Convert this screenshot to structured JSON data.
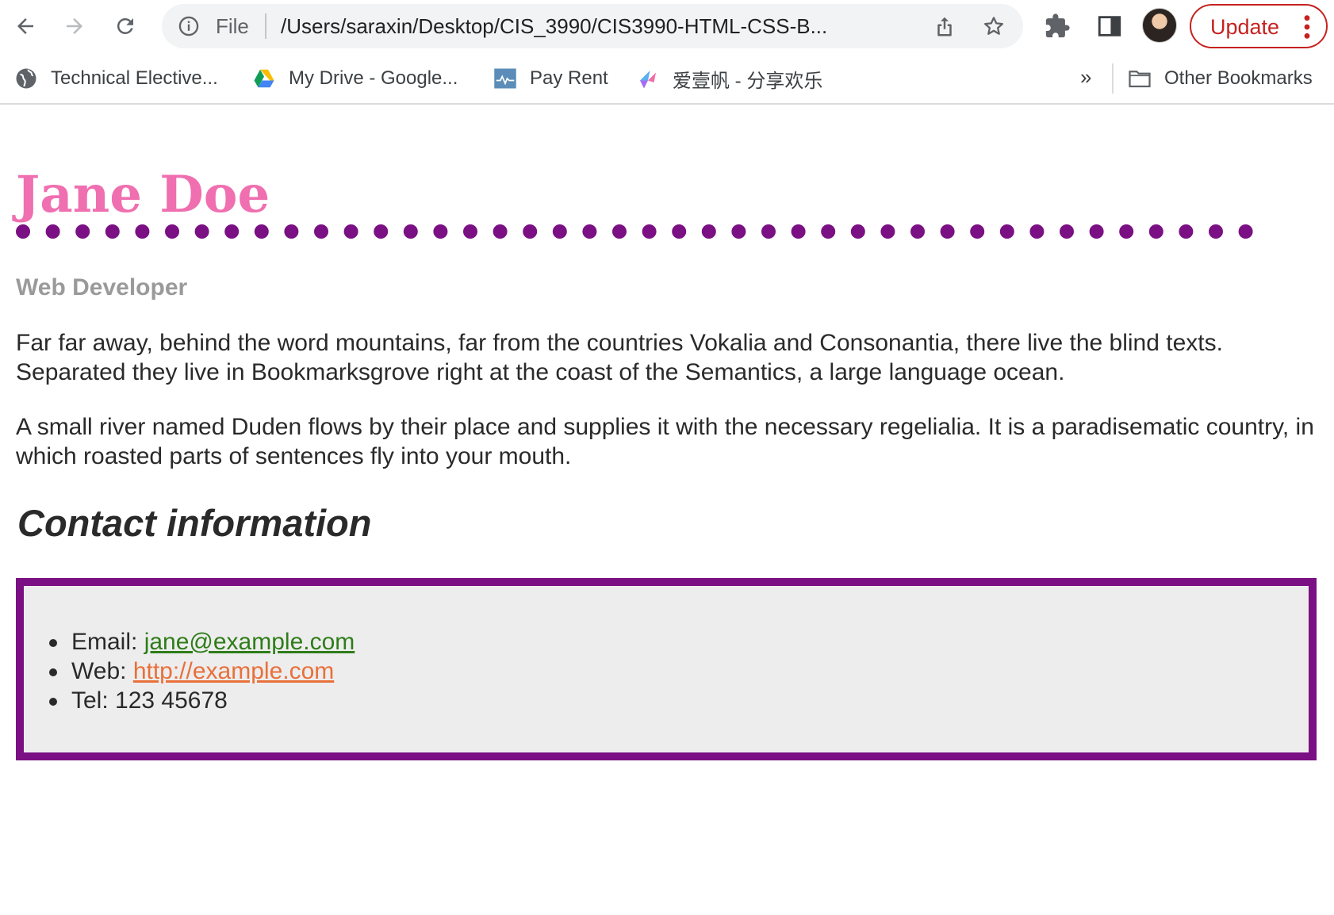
{
  "browser": {
    "omnibox": {
      "scheme_label": "File",
      "url": "/Users/saraxin/Desktop/CIS_3990/CIS3990-HTML-CSS-B..."
    },
    "update_label": "Update",
    "icons": {
      "back": "back-arrow-icon",
      "forward": "forward-arrow-icon",
      "reload": "reload-icon",
      "info": "info-icon",
      "share": "share-icon",
      "bookmark_star": "star-icon",
      "extensions": "puzzle-icon",
      "side_panel": "side-panel-icon",
      "menu": "kebab-menu-icon"
    },
    "colors": {
      "update_red": "#c5221f",
      "omnibox_bg": "#f1f3f4"
    }
  },
  "bookmarks": {
    "items": [
      {
        "label": "Technical Elective...",
        "icon": "globe-icon"
      },
      {
        "label": "My Drive - Google...",
        "icon": "google-drive-icon"
      },
      {
        "label": "Pay Rent",
        "icon": "pay-rent-icon"
      },
      {
        "label": "爱壹帆 - 分享欢乐",
        "icon": "aiyifan-icon"
      }
    ],
    "overflow_label": "»",
    "other_label": "Other Bookmarks",
    "other_icon": "folder-icon"
  },
  "page": {
    "name": "Jane Doe",
    "role": "Web Developer",
    "paragraphs": [
      "Far far away, behind the word mountains, far from the countries Vokalia and Consonantia, there live the blind texts. Separated they live in Bookmarksgrove right at the coast of the Semantics, a large language ocean.",
      "A small river named Duden flows by their place and supplies it with the necessary regelialia. It is a paradisematic country, in which roasted parts of sentences fly into your mouth."
    ],
    "contact_heading": "Contact information",
    "contact": {
      "email_label": "Email: ",
      "email_value": "jane@example.com",
      "web_label": "Web: ",
      "web_value": "http://example.com",
      "tel_label": "Tel: ",
      "tel_value": "123 45678"
    },
    "colors": {
      "name_pink": "#ef6fb0",
      "accent_purple": "#7a1083",
      "role_gray": "#9a9a9a",
      "email_green": "#2e7d18",
      "web_orange": "#e8703a",
      "box_bg": "#eeedee"
    }
  }
}
